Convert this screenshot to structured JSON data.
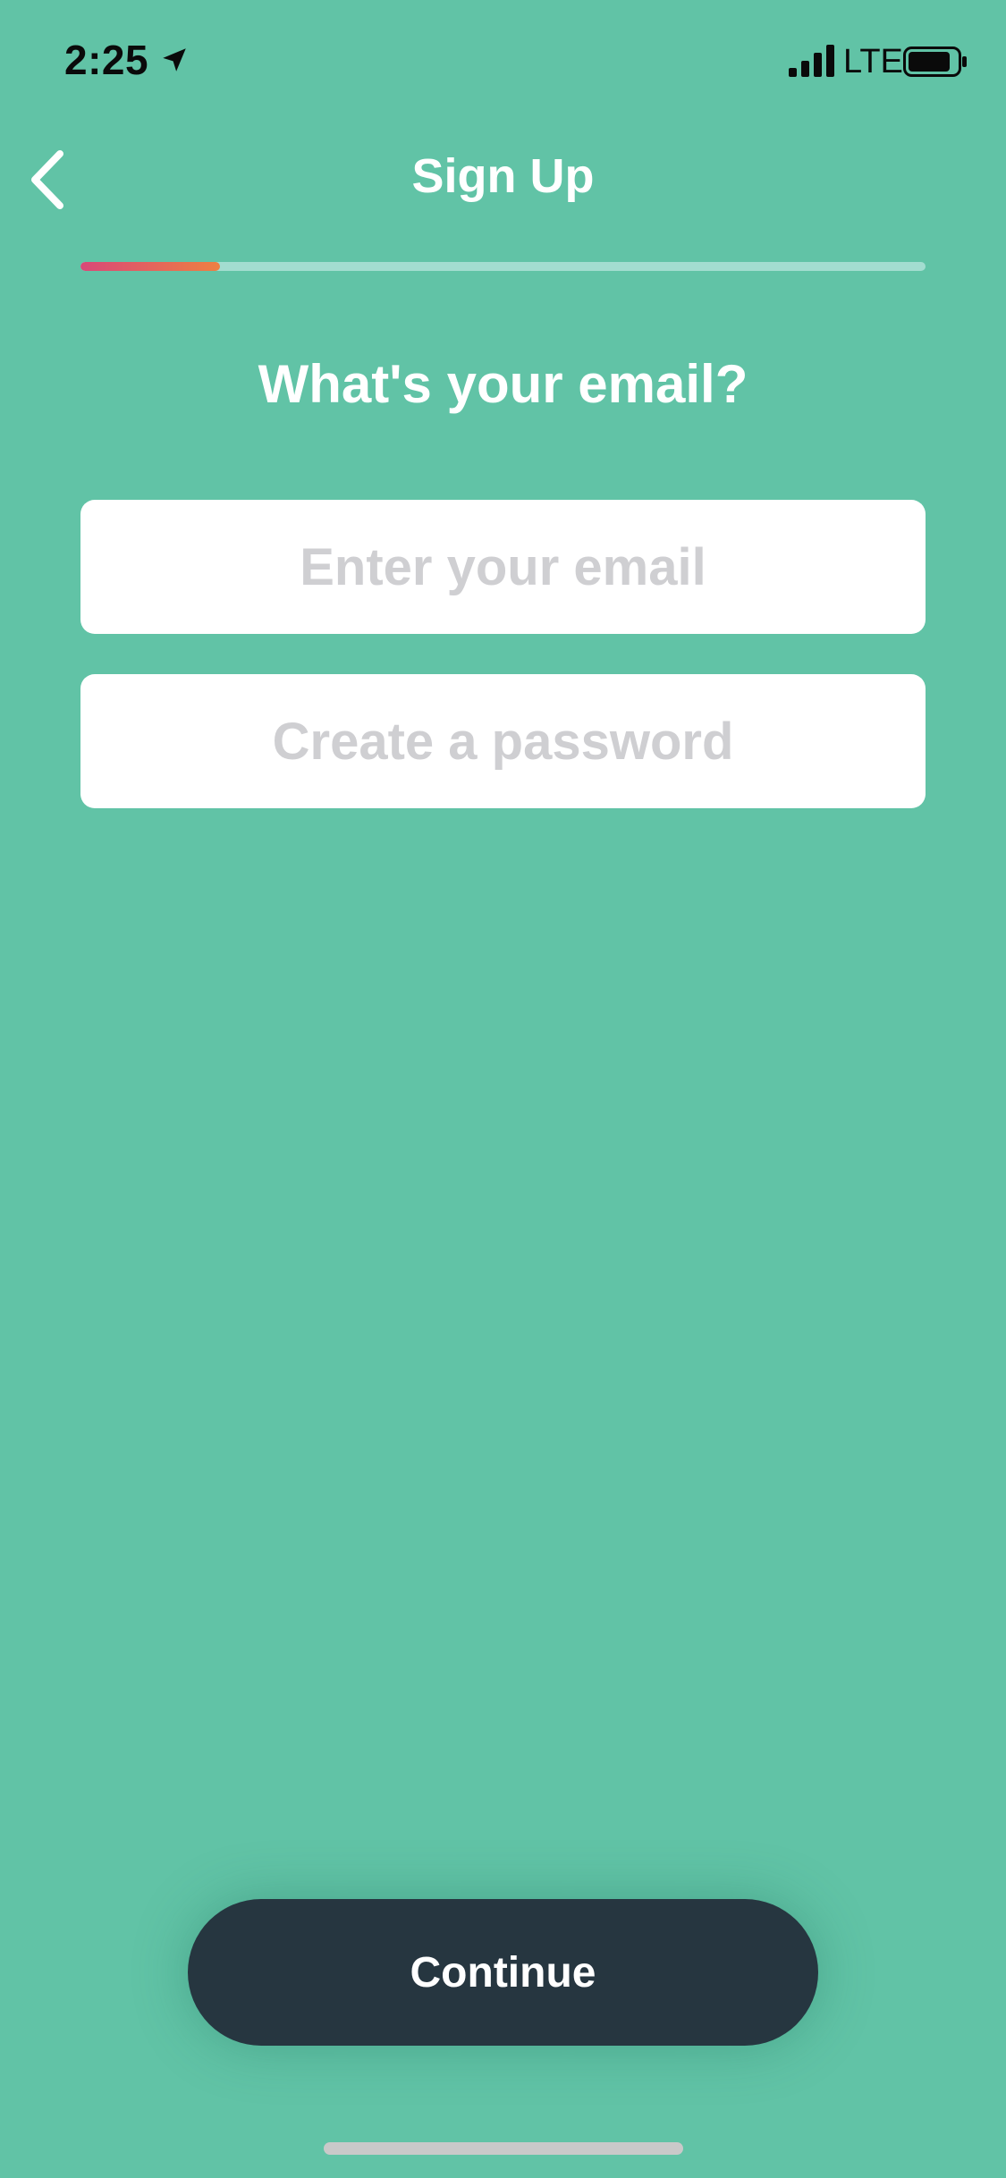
{
  "status_bar": {
    "time": "2:25",
    "network": "LTE",
    "signal_bars": 4,
    "icons": [
      "location-arrow-icon",
      "cellular-signal-icon",
      "battery-icon"
    ]
  },
  "nav": {
    "title": "Sign Up",
    "back_icon": "chevron-left-icon"
  },
  "progress": {
    "fraction": 0.165,
    "colors": {
      "start": "#d94878",
      "end": "#ee8042",
      "track": "#a3ddd0"
    }
  },
  "question": "What's your email?",
  "form": {
    "email_placeholder": "Enter your email",
    "email_value": "",
    "password_placeholder": "Create a password",
    "password_value": ""
  },
  "continue_label": "Continue",
  "colors": {
    "background": "#61c3a6",
    "button": "#263640",
    "text_on_accent": "#ffffff"
  }
}
